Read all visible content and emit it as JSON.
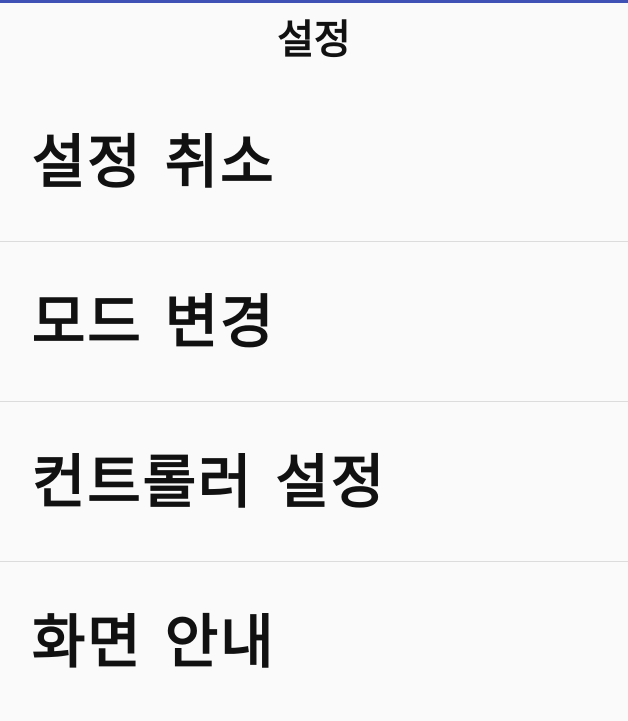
{
  "colors": {
    "accent": "#3f51b5",
    "background": "#fafafa",
    "divider": "#dcdcdc",
    "text": "#111111"
  },
  "header": {
    "title": "설정"
  },
  "menu": {
    "items": [
      {
        "label": "설정 취소"
      },
      {
        "label": "모드 변경"
      },
      {
        "label": "컨트롤러 설정"
      },
      {
        "label": "화면 안내"
      }
    ]
  }
}
